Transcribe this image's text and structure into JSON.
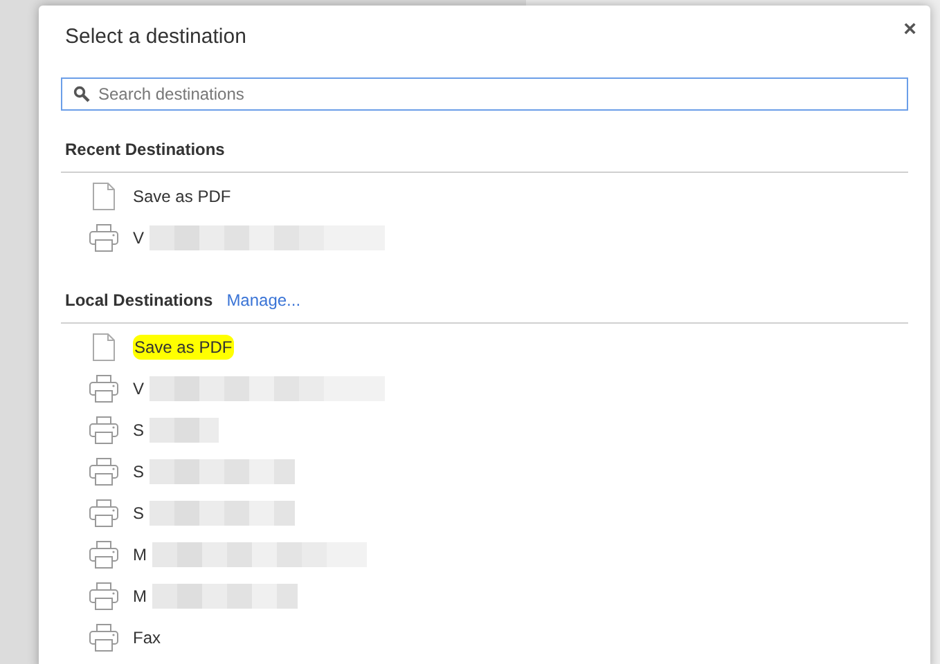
{
  "dialog": {
    "title": "Select a destination",
    "close": "×"
  },
  "search": {
    "placeholder": "Search destinations"
  },
  "sections": [
    {
      "title": "Recent Destinations",
      "items": [
        {
          "kind": "document",
          "label": "Save as PDF",
          "highlighted": false,
          "redacted": false
        },
        {
          "kind": "printer",
          "label": "V",
          "highlighted": false,
          "redacted": true
        }
      ]
    },
    {
      "title": "Local Destinations",
      "link": "Manage...",
      "items": [
        {
          "kind": "document",
          "label": "Save as PDF",
          "highlighted": true,
          "redacted": false
        },
        {
          "kind": "printer",
          "label": "V",
          "highlighted": false,
          "redacted": true
        },
        {
          "kind": "printer",
          "label": "S",
          "highlighted": false,
          "redacted": true
        },
        {
          "kind": "printer",
          "label": "S",
          "highlighted": false,
          "redacted": true
        },
        {
          "kind": "printer",
          "label": "S",
          "highlighted": false,
          "redacted": true
        },
        {
          "kind": "printer",
          "label": "M",
          "highlighted": false,
          "redacted": true
        },
        {
          "kind": "printer",
          "label": "M",
          "highlighted": false,
          "redacted": true
        },
        {
          "kind": "printer",
          "label": "Fax",
          "highlighted": false,
          "redacted": false
        }
      ]
    }
  ]
}
